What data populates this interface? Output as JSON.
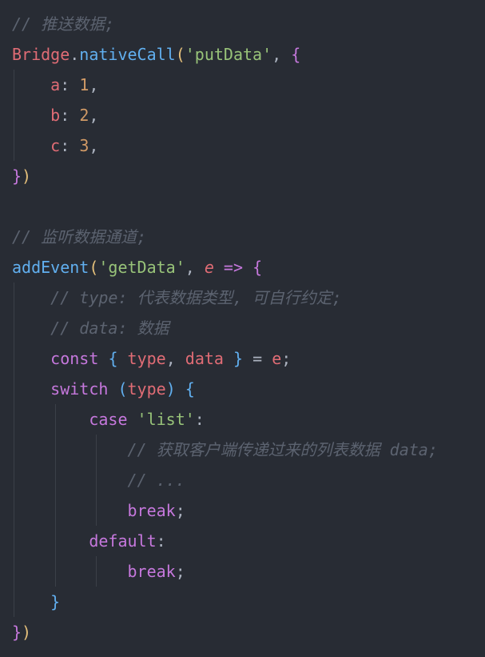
{
  "editor": {
    "language": "javascript",
    "theme": "dark",
    "colors": {
      "background": "#282c34",
      "comment": "#5c6370",
      "keyword": "#c678dd",
      "function": "#61afef",
      "string": "#98c379",
      "number": "#d19a66",
      "variable": "#e06c75",
      "punctuation": "#abb2bf",
      "bracket": "#e5c07b",
      "indent_guide": "#3b4048"
    },
    "lines": [
      [
        {
          "t": "// 推送数据;",
          "c": "comment"
        }
      ],
      [
        {
          "t": "Bridge",
          "c": "var"
        },
        {
          "t": ".",
          "c": "punct"
        },
        {
          "t": "nativeCall",
          "c": "func"
        },
        {
          "t": "(",
          "c": "brace-0"
        },
        {
          "t": "'putData'",
          "c": "string"
        },
        {
          "t": ", ",
          "c": "punct"
        },
        {
          "t": "{",
          "c": "brace-1"
        }
      ],
      [
        {
          "t": "    ",
          "c": "punct"
        },
        {
          "t": "a",
          "c": "prop"
        },
        {
          "t": ": ",
          "c": "punct"
        },
        {
          "t": "1",
          "c": "number"
        },
        {
          "t": ",",
          "c": "punct"
        }
      ],
      [
        {
          "t": "    ",
          "c": "punct"
        },
        {
          "t": "b",
          "c": "prop"
        },
        {
          "t": ": ",
          "c": "punct"
        },
        {
          "t": "2",
          "c": "number"
        },
        {
          "t": ",",
          "c": "punct"
        }
      ],
      [
        {
          "t": "    ",
          "c": "punct"
        },
        {
          "t": "c",
          "c": "prop"
        },
        {
          "t": ": ",
          "c": "punct"
        },
        {
          "t": "3",
          "c": "number"
        },
        {
          "t": ",",
          "c": "punct"
        }
      ],
      [
        {
          "t": "}",
          "c": "brace-1"
        },
        {
          "t": ")",
          "c": "brace-0"
        }
      ],
      [],
      [
        {
          "t": "// 监听数据通道;",
          "c": "comment"
        }
      ],
      [
        {
          "t": "addEvent",
          "c": "func"
        },
        {
          "t": "(",
          "c": "brace-0"
        },
        {
          "t": "'getData'",
          "c": "string"
        },
        {
          "t": ", ",
          "c": "punct"
        },
        {
          "t": "e",
          "c": "param"
        },
        {
          "t": " => ",
          "c": "op"
        },
        {
          "t": "{",
          "c": "brace-1"
        }
      ],
      [
        {
          "t": "    ",
          "c": "punct"
        },
        {
          "t": "// type: 代表数据类型, 可自行约定;",
          "c": "comment"
        }
      ],
      [
        {
          "t": "    ",
          "c": "punct"
        },
        {
          "t": "// data: 数据",
          "c": "comment"
        }
      ],
      [
        {
          "t": "    ",
          "c": "punct"
        },
        {
          "t": "const",
          "c": "keyword"
        },
        {
          "t": " ",
          "c": "punct"
        },
        {
          "t": "{",
          "c": "brace-2"
        },
        {
          "t": " ",
          "c": "punct"
        },
        {
          "t": "type",
          "c": "var"
        },
        {
          "t": ", ",
          "c": "punct"
        },
        {
          "t": "data",
          "c": "var"
        },
        {
          "t": " ",
          "c": "punct"
        },
        {
          "t": "}",
          "c": "brace-2"
        },
        {
          "t": " = ",
          "c": "punct"
        },
        {
          "t": "e",
          "c": "var"
        },
        {
          "t": ";",
          "c": "punct"
        }
      ],
      [
        {
          "t": "    ",
          "c": "punct"
        },
        {
          "t": "switch",
          "c": "keyword"
        },
        {
          "t": " ",
          "c": "punct"
        },
        {
          "t": "(",
          "c": "brace-2"
        },
        {
          "t": "type",
          "c": "var"
        },
        {
          "t": ")",
          "c": "brace-2"
        },
        {
          "t": " ",
          "c": "punct"
        },
        {
          "t": "{",
          "c": "brace-2"
        }
      ],
      [
        {
          "t": "        ",
          "c": "punct"
        },
        {
          "t": "case",
          "c": "keyword"
        },
        {
          "t": " ",
          "c": "punct"
        },
        {
          "t": "'list'",
          "c": "string"
        },
        {
          "t": ":",
          "c": "punct"
        }
      ],
      [
        {
          "t": "            ",
          "c": "punct"
        },
        {
          "t": "// 获取客户端传递过来的列表数据 data;",
          "c": "comment"
        }
      ],
      [
        {
          "t": "            ",
          "c": "punct"
        },
        {
          "t": "// ...",
          "c": "comment"
        }
      ],
      [
        {
          "t": "            ",
          "c": "punct"
        },
        {
          "t": "break",
          "c": "keyword"
        },
        {
          "t": ";",
          "c": "punct"
        }
      ],
      [
        {
          "t": "        ",
          "c": "punct"
        },
        {
          "t": "default",
          "c": "keyword"
        },
        {
          "t": ":",
          "c": "punct"
        }
      ],
      [
        {
          "t": "            ",
          "c": "punct"
        },
        {
          "t": "break",
          "c": "keyword"
        },
        {
          "t": ";",
          "c": "punct"
        }
      ],
      [
        {
          "t": "    ",
          "c": "punct"
        },
        {
          "t": "}",
          "c": "brace-2"
        }
      ],
      [
        {
          "t": "}",
          "c": "brace-1"
        },
        {
          "t": ")",
          "c": "brace-0"
        }
      ]
    ]
  }
}
